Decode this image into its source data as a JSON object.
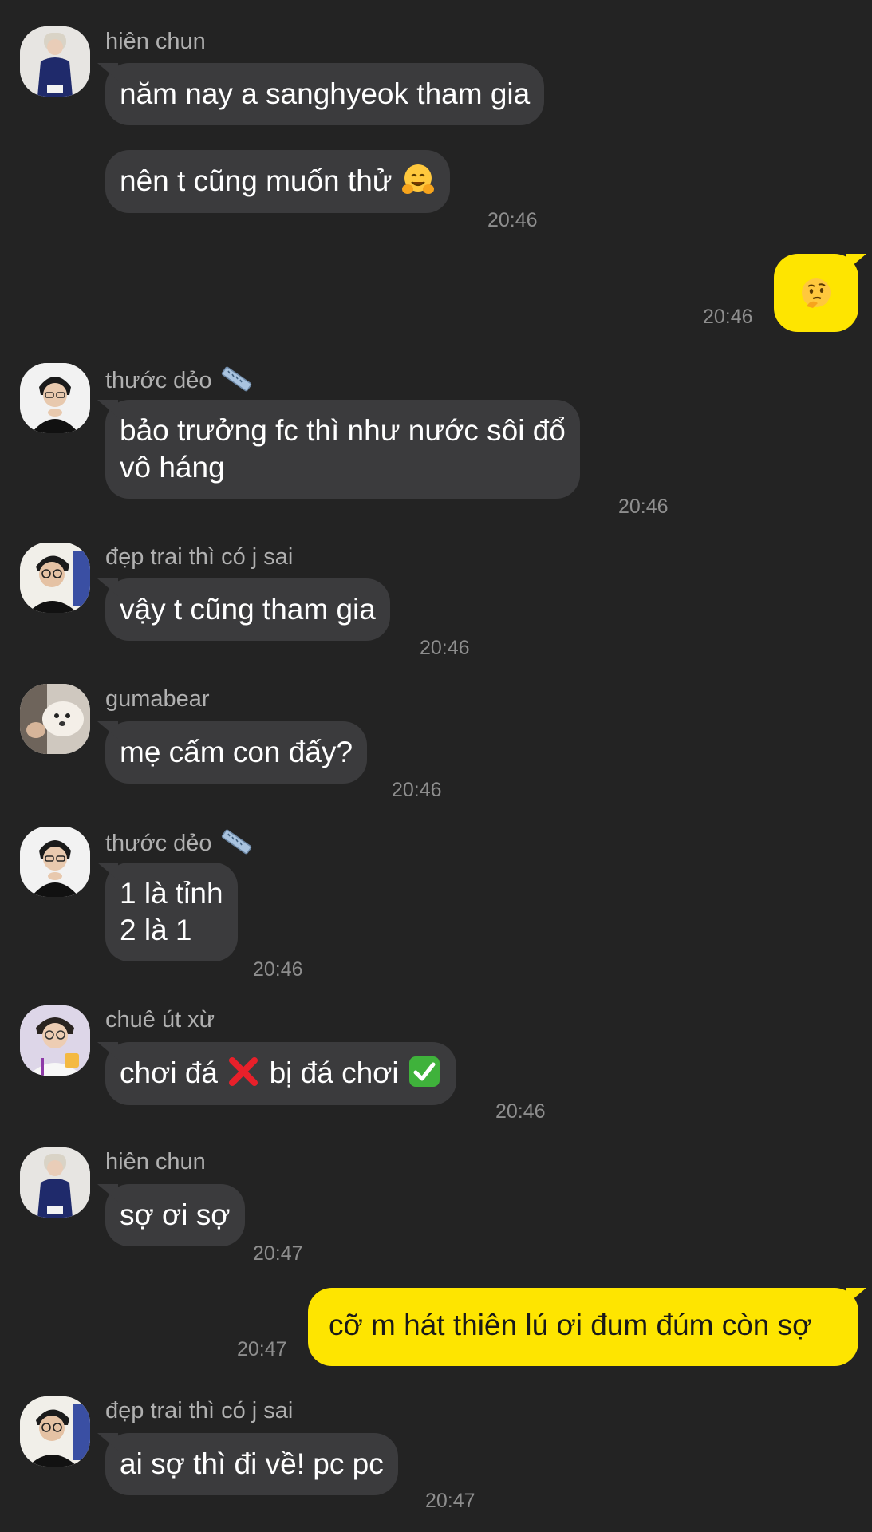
{
  "messages": [
    {
      "sender": "hiên chun",
      "lines": [
        "năm nay a sanghyeok tham gia"
      ]
    },
    {
      "lines": [
        "nên t cũng muốn thử"
      ],
      "emoji": "hugging-face-icon",
      "time": "20:46"
    },
    {
      "mine": true,
      "emoji": "thinking-face-icon",
      "time": "20:46"
    },
    {
      "sender": "thước dẻo",
      "sender_icon": "ruler-icon",
      "lines": [
        "bảo trưởng fc thì như nước sôi đổ",
        "vô háng"
      ],
      "time": "20:46"
    },
    {
      "sender": "đẹp trai thì có j sai",
      "lines": [
        "vậy t cũng tham gia"
      ],
      "time": "20:46"
    },
    {
      "sender": "gumabear",
      "lines": [
        "mẹ cấm con đấy?"
      ],
      "time": "20:46"
    },
    {
      "sender": "thước dẻo",
      "sender_icon": "ruler-icon",
      "lines": [
        "1 là tỉnh",
        "2 là 1"
      ],
      "time": "20:46"
    },
    {
      "sender": "chuê út xừ",
      "parts": [
        "chơi đá",
        "bị đá chơi"
      ],
      "emojis": [
        "cross-mark-icon",
        "check-mark-button-icon"
      ],
      "time": "20:46"
    },
    {
      "sender": "hiên chun",
      "lines": [
        "sợ ơi sợ"
      ],
      "time": "20:47"
    },
    {
      "mine": true,
      "lines": [
        "cỡ m hát thiên lú ơi đum đúm còn sợ"
      ],
      "time": "20:47"
    },
    {
      "sender": "đẹp trai thì có j sai",
      "lines": [
        "ai sợ thì đi về! pc pc"
      ],
      "time": "20:47"
    }
  ],
  "colors": {
    "background": "#232323",
    "bubble_other": "#3b3b3d",
    "bubble_mine": "#fee500",
    "sender_text": "#b0b0b0",
    "time_text": "#8e8e8e"
  }
}
